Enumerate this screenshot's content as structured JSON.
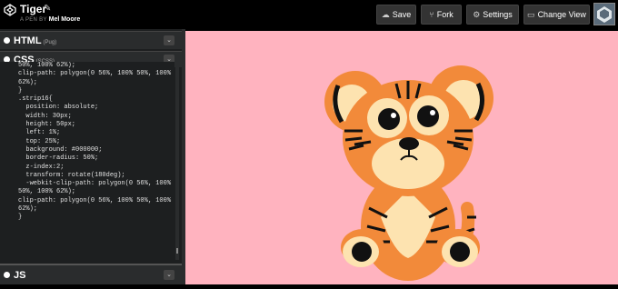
{
  "header": {
    "title": "Tiger",
    "byline_prefix": "A PEN BY",
    "author": "Mel Moore",
    "buttons": {
      "save": "Save",
      "fork": "Fork",
      "settings": "Settings",
      "change_view": "Change View"
    }
  },
  "editor": {
    "html_panel": {
      "name": "HTML",
      "preprocessor": "(Pug)"
    },
    "css_panel": {
      "name": "CSS",
      "preprocessor": "(SCSS)"
    },
    "js_panel": {
      "name": "JS"
    },
    "code_lines": [
      {
        "ln": "",
        "text": "50%, 100% 62%);"
      },
      {
        "ln": "",
        "text": "clip-path: polygon(0 56%, 100% 50%, 100%"
      },
      {
        "ln": "",
        "text": "62%);"
      },
      {
        "ln": "",
        "text": "}"
      },
      {
        "ln": "",
        "text": ".strip16{"
      },
      {
        "ln": "",
        "text": "  position: absolute;"
      },
      {
        "ln": "",
        "text": "  width: 30px;"
      },
      {
        "ln": "",
        "text": "  height: 50px;"
      },
      {
        "ln": "",
        "text": "  left: 1%;"
      },
      {
        "ln": "",
        "text": "  top: 25%;"
      },
      {
        "ln": "",
        "text": "  background: #000000;"
      },
      {
        "ln": "",
        "text": "  border-radius: 50%;"
      },
      {
        "ln": "",
        "text": "  z-index:2;"
      },
      {
        "ln": "",
        "text": "  transform: rotate(180deg);"
      },
      {
        "ln": "",
        "text": "  -webkit-clip-path: polygon(0 56%, 100%"
      },
      {
        "ln": "",
        "text": "50%, 100% 62%);"
      },
      {
        "ln": "",
        "text": "clip-path: polygon(0 56%, 100% 50%, 100%"
      },
      {
        "ln": "",
        "text": "62%);"
      },
      {
        "ln": "",
        "text": "}"
      }
    ]
  },
  "icons": {
    "logo": "codepen-logo-icon",
    "edit": "pencil-icon",
    "save": "cloud-icon",
    "fork": "fork-icon",
    "settings": "gear-icon",
    "change_view": "layout-icon",
    "collapse": "chevron-down-icon",
    "user": "avatar"
  },
  "colors": {
    "preview_bg": "#ffb3bf",
    "tiger_orange": "#f28a3a",
    "tiger_cream": "#fde3b0"
  }
}
